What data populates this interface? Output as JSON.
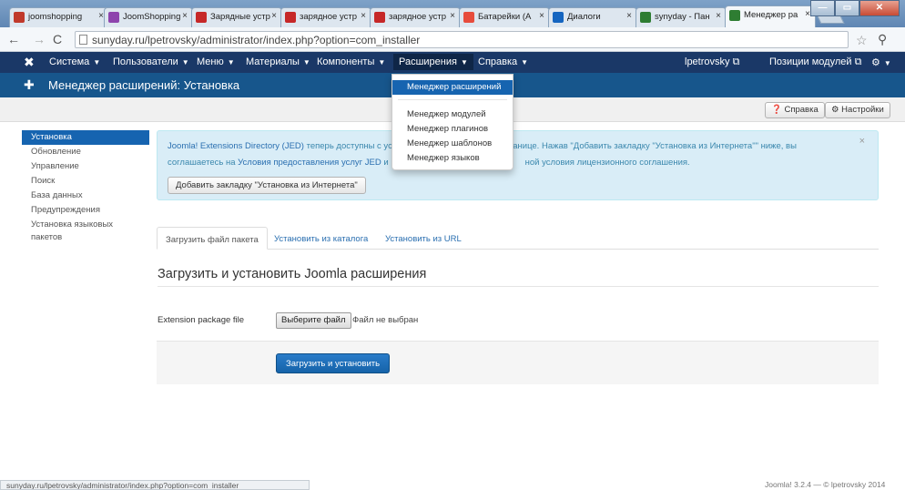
{
  "browser": {
    "tabs": [
      {
        "label": "joomshopping",
        "color": "#c0392b"
      },
      {
        "label": "JoomShopping",
        "color": "#8e44ad"
      },
      {
        "label": "Зарядные устр",
        "color": "#c62828"
      },
      {
        "label": "зарядное устр",
        "color": "#c62828"
      },
      {
        "label": "зарядное устр",
        "color": "#c62828"
      },
      {
        "label": "Батарейки (А",
        "color": "#e74c3c"
      },
      {
        "label": "Диалоги",
        "color": "#1565c0"
      },
      {
        "label": "synyday - Пан",
        "color": "#2e7d32"
      },
      {
        "label": "Менеджер ра",
        "color": "#2e7d32"
      }
    ],
    "tab_close": "×",
    "url": "sunyday.ru/lpetrovsky/administrator/index.php?option=com_installer",
    "window_buttons": {
      "minimize": "—",
      "maximize": "▭",
      "close": "✕"
    }
  },
  "navbar": {
    "logo": "✖",
    "items": [
      {
        "label": "Система"
      },
      {
        "label": "Пользователи"
      },
      {
        "label": "Меню"
      },
      {
        "label": "Материалы"
      },
      {
        "label": "Компоненты"
      },
      {
        "label": "Расширения"
      },
      {
        "label": "Справка"
      }
    ],
    "user": "lpetrovsky",
    "positions": "Позиции модулей",
    "gear": "⚙"
  },
  "header": {
    "title": "Менеджер расширений: Установка"
  },
  "toolbar": {
    "help": "Справка",
    "settings": "Настройки"
  },
  "dropdown": {
    "items": [
      "Менеджер расширений",
      "Менеджер модулей",
      "Менеджер плагинов",
      "Менеджер шаблонов",
      "Менеджер языков"
    ]
  },
  "sidebar": {
    "items": [
      "Установка",
      "Обновление",
      "Управление",
      "Поиск",
      "База данных",
      "Предупреждения",
      "Установка языковых",
      "пакетов"
    ]
  },
  "alert": {
    "line1_link": "Joomla! Extensions Directory (JED)",
    "line1_text": " теперь доступны с ус",
    "line1_tail": "странице.  Нажав \"Добавить закладку \"Установка из Интернета\"\" ниже, вы",
    "line2_text": "соглашаетесь на ",
    "line2_link": "Условия предоставления услуг JED",
    "line2_mid": " и",
    "line2_tail": "ной условия лицензионного соглашения.",
    "button": "Добавить закладку \"Установка из Интернета\"",
    "close": "×"
  },
  "tabs": [
    "Загрузить файл пакета",
    "Установить из каталога",
    "Установить из URL"
  ],
  "main": {
    "section_title": "Загрузить и установить Joomla расширения",
    "field_label": "Extension package file",
    "file_button": "Выберите файл",
    "file_status": "Файл не выбран",
    "submit": "Загрузить и установить"
  },
  "footer": {
    "status_url": "sunyday.ru/lpetrovsky/administrator/index.php?option=com_installer",
    "copyright": "Joomla! 3.2.4  —  © lpetrovsky 2014"
  }
}
